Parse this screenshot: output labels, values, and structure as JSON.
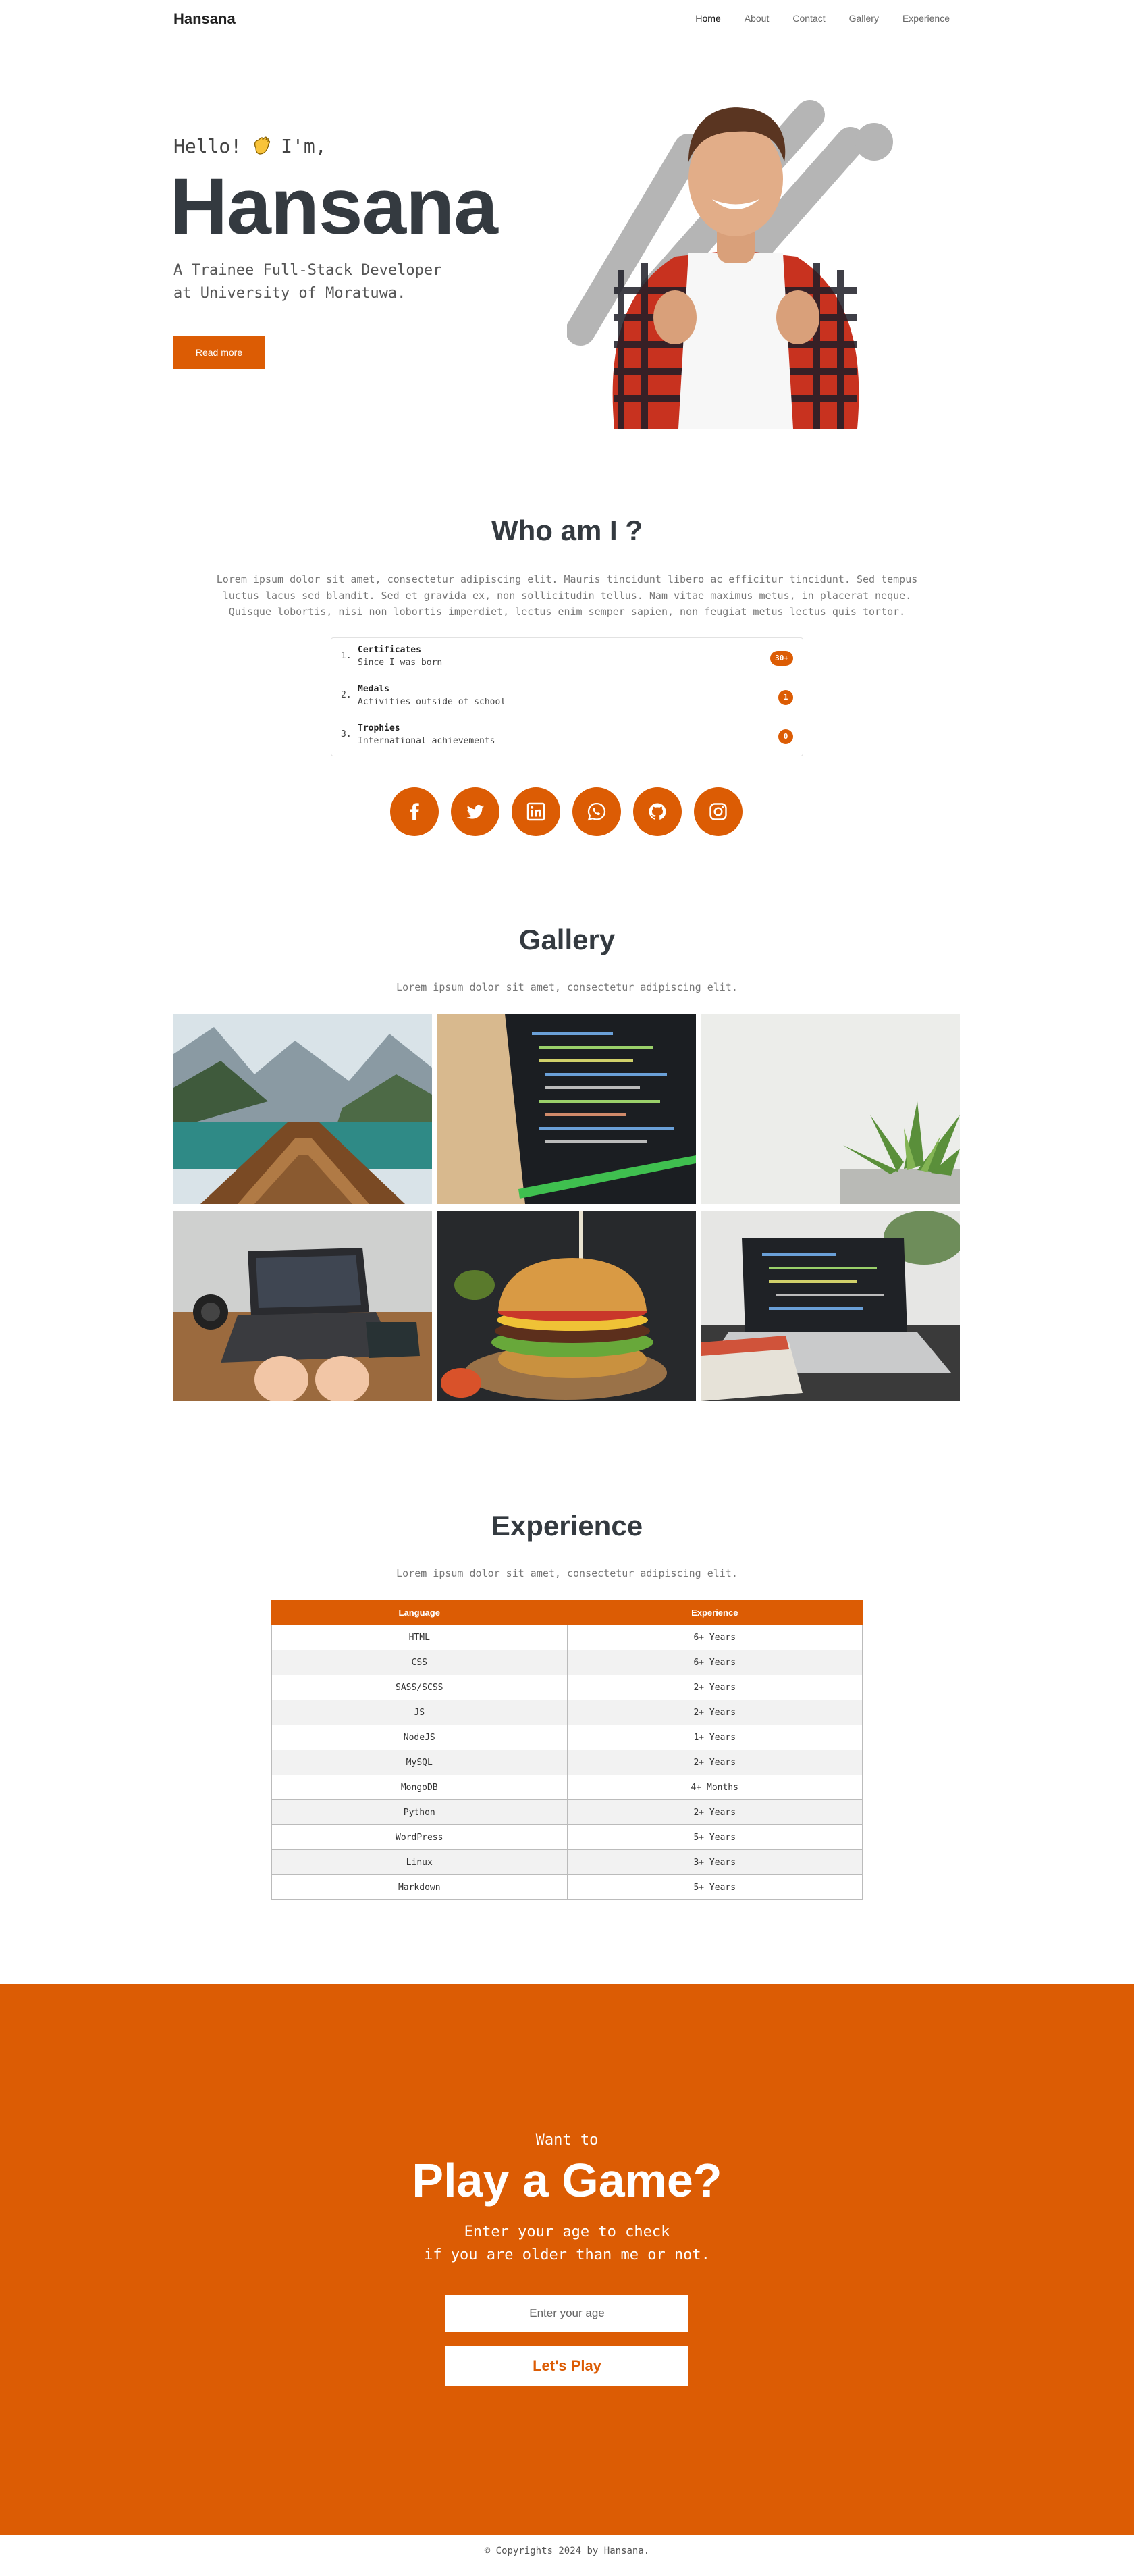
{
  "nav": {
    "brand": "Hansana",
    "links": [
      "Home",
      "About",
      "Contact",
      "Gallery",
      "Experience"
    ],
    "active": "Home"
  },
  "hero": {
    "greeting": "Hello!",
    "greeting_suffix": "I'm,",
    "name": "Hansana",
    "subtitle_line1": "A Trainee Full-Stack Developer",
    "subtitle_line2": "at University of Moratuwa.",
    "button": "Read more"
  },
  "about": {
    "title": "Who am I ?",
    "text_line1": "Lorem ipsum dolor sit amet, consectetur adipiscing elit. Mauris tincidunt libero ac efficitur tincidunt. Sed tempus",
    "text_line2": "luctus lacus sed blandit. Sed et gravida ex, non sollicitudin tellus. Nam vitae maximus metus, in placerat neque.",
    "text_line3": "Quisque lobortis, nisi non lobortis imperdiet, lectus enim semper sapien, non feugiat metus lectus quis tortor.",
    "items": [
      {
        "num": "1.",
        "title": "Certificates",
        "desc": "Since I was born",
        "badge": "30+"
      },
      {
        "num": "2.",
        "title": "Medals",
        "desc": "Activities outside of school",
        "badge": "1"
      },
      {
        "num": "3.",
        "title": "Trophies",
        "desc": "International achievements",
        "badge": "0"
      }
    ],
    "socials": [
      "facebook-icon",
      "twitter-icon",
      "linkedin-icon",
      "whatsapp-icon",
      "github-icon",
      "instagram-icon"
    ]
  },
  "gallery": {
    "title": "Gallery",
    "text": "Lorem ipsum dolor sit amet, consectetur adipiscing elit."
  },
  "experience": {
    "title": "Experience",
    "text": "Lorem ipsum dolor sit amet, consectetur adipiscing elit.",
    "headers": [
      "Language",
      "Experience"
    ],
    "rows": [
      [
        "HTML",
        "6+ Years"
      ],
      [
        "CSS",
        "6+ Years"
      ],
      [
        "SASS/SCSS",
        "2+ Years"
      ],
      [
        "JS",
        "2+ Years"
      ],
      [
        "NodeJS",
        "1+ Years"
      ],
      [
        "MySQL",
        "2+ Years"
      ],
      [
        "MongoDB",
        "4+ Months"
      ],
      [
        "Python",
        "2+ Years"
      ],
      [
        "WordPress",
        "5+ Years"
      ],
      [
        "Linux",
        "3+ Years"
      ],
      [
        "Markdown",
        "5+ Years"
      ]
    ]
  },
  "game": {
    "want": "Want to",
    "title": "Play a Game?",
    "sub_line1": "Enter your age to check",
    "sub_line2": "if you are older than me or not.",
    "placeholder": "Enter your age",
    "button": "Let's Play"
  },
  "footer": "© Copyrights 2024 by Hansana.",
  "colors": {
    "accent": "#dc5c04",
    "heading": "#343a40"
  }
}
